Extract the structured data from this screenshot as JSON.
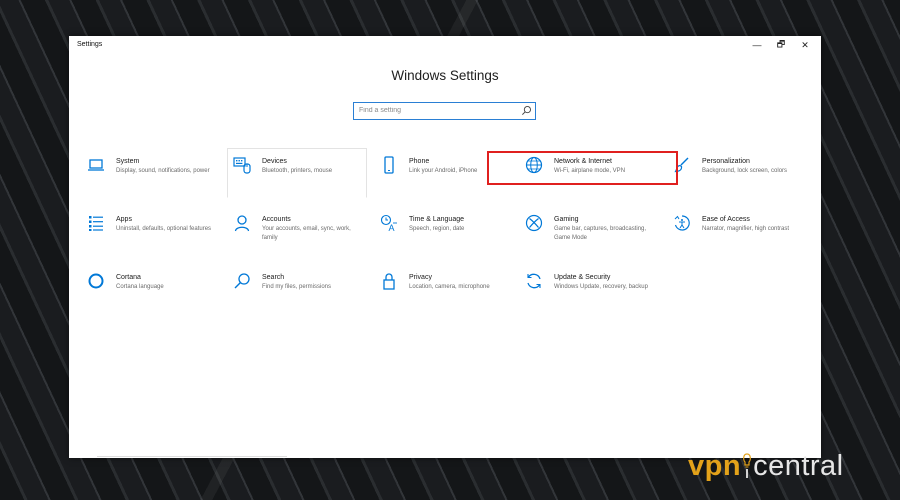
{
  "window": {
    "app_title": "Settings",
    "heading": "Windows Settings",
    "controls": {
      "minimize": "—",
      "maximize": "🗗",
      "close": "✕"
    }
  },
  "search": {
    "placeholder": "Find a setting",
    "value": ""
  },
  "tiles": [
    {
      "title": "System",
      "desc": "Display, sound, notifications, power",
      "icon": "laptop-icon"
    },
    {
      "title": "Devices",
      "desc": "Bluetooth, printers, mouse",
      "icon": "keyboard-icon"
    },
    {
      "title": "Phone",
      "desc": "Link your Android, iPhone",
      "icon": "phone-icon"
    },
    {
      "title": "Network & Internet",
      "desc": "Wi-Fi, airplane mode, VPN",
      "icon": "globe-icon"
    },
    {
      "title": "Personalization",
      "desc": "Background, lock screen, colors",
      "icon": "brush-icon"
    },
    {
      "title": "Apps",
      "desc": "Uninstall, defaults, optional features",
      "icon": "apps-list-icon"
    },
    {
      "title": "Accounts",
      "desc": "Your accounts, email, sync, work, family",
      "icon": "person-icon"
    },
    {
      "title": "Time & Language",
      "desc": "Speech, region, date",
      "icon": "time-language-icon"
    },
    {
      "title": "Gaming",
      "desc": "Game bar, captures, broadcasting, Game Mode",
      "icon": "xbox-icon"
    },
    {
      "title": "Ease of Access",
      "desc": "Narrator, magnifier, high contrast",
      "icon": "ease-of-access-icon"
    },
    {
      "title": "Cortana",
      "desc": "Cortana language",
      "icon": "cortana-icon"
    },
    {
      "title": "Search",
      "desc": "Find my files, permissions",
      "icon": "search-icon"
    },
    {
      "title": "Privacy",
      "desc": "Location, camera, microphone",
      "icon": "lock-icon"
    },
    {
      "title": "Update & Security",
      "desc": "Windows Update, recovery, backup",
      "icon": "sync-icon"
    }
  ],
  "watermark": {
    "part1": "vpn",
    "part2": "central"
  },
  "colors": {
    "accent": "#0078d7",
    "highlight": "#e0201f",
    "brand_orange": "#e3a21a"
  }
}
